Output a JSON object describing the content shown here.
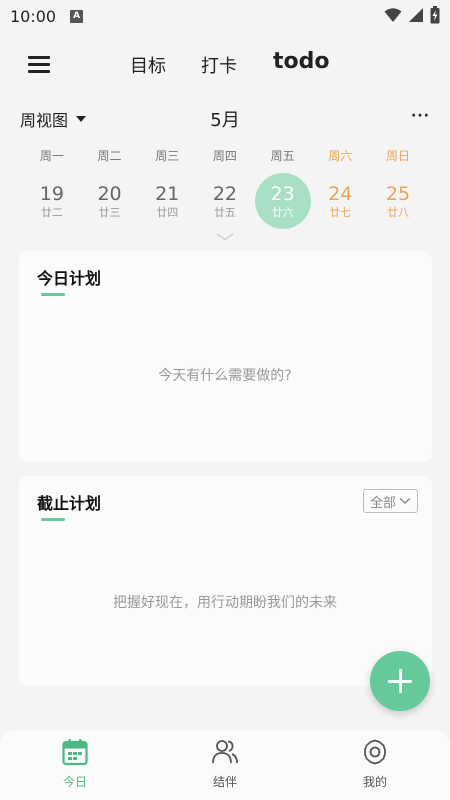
{
  "status_bar": {
    "time": "10:00",
    "notification_badge": "A"
  },
  "top_nav": {
    "tabs": [
      {
        "label": "目标"
      },
      {
        "label": "打卡"
      },
      {
        "label": "todo",
        "active": true
      }
    ]
  },
  "calendar": {
    "view_mode": "周视图",
    "month": "5月",
    "more": "···",
    "weekdays": [
      "周一",
      "周二",
      "周三",
      "周四",
      "周五",
      "周六",
      "周日"
    ],
    "days": [
      {
        "num": "19",
        "lunar": "廿二"
      },
      {
        "num": "20",
        "lunar": "廿三"
      },
      {
        "num": "21",
        "lunar": "廿四"
      },
      {
        "num": "22",
        "lunar": "廿五"
      },
      {
        "num": "23",
        "lunar": "廿六",
        "selected": true
      },
      {
        "num": "24",
        "lunar": "廿七"
      },
      {
        "num": "25",
        "lunar": "廿八"
      }
    ]
  },
  "today_plan": {
    "title": "今日计划",
    "empty_text": "今天有什么需要做的?"
  },
  "deadline_plan": {
    "title": "截止计划",
    "filter": "全部",
    "empty_text": "把握好现在，用行动期盼我们的未来"
  },
  "bottom_nav": {
    "items": [
      {
        "label": "今日",
        "icon": "calendar-icon",
        "active": true
      },
      {
        "label": "结伴",
        "icon": "partner-icon"
      },
      {
        "label": "我的",
        "icon": "gear-icon"
      }
    ]
  },
  "colors": {
    "accent": "#66c99a",
    "selected_day": "#a8dfc4",
    "weekend": "#e8a55a",
    "background": "#f4f4f4"
  }
}
